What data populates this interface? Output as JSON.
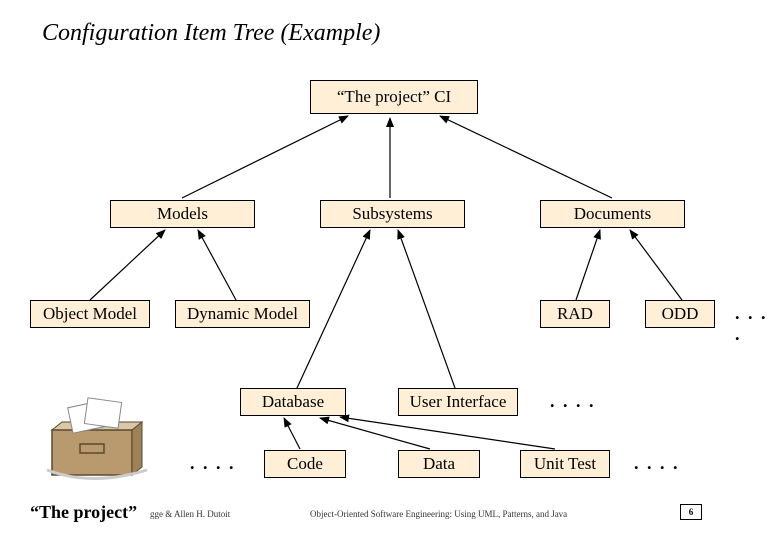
{
  "title": "Configuration Item Tree (Example)",
  "nodes": {
    "root": "“The project” CI",
    "models": "Models",
    "subsystems": "Subsystems",
    "documents": "Documents",
    "object_model": "Object Model",
    "dynamic_model": "Dynamic Model",
    "rad": "RAD",
    "odd": "ODD",
    "database": "Database",
    "user_interface": "User Interface",
    "code": "Code",
    "data": "Data",
    "unit_test": "Unit Test"
  },
  "ellipsis": ". . . .",
  "project_label": "“The project”",
  "footer": {
    "author_fragment": "gge & Allen H. Dutoit",
    "center": "Object-Oriented Software Engineering: Using UML, Patterns, and Java"
  },
  "page_no": "6"
}
